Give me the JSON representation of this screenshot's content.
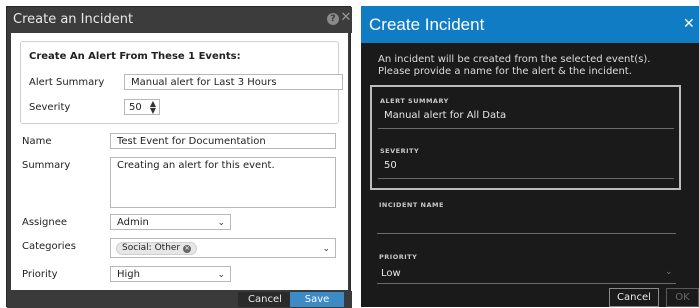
{
  "left_dialog": {
    "title": "Create an Incident",
    "help_icon": "?",
    "close_icon": "✕",
    "group_title": "Create An Alert From These 1 Events:",
    "alert_summary_label": "Alert Summary",
    "alert_summary_value": "Manual alert for Last 3 Hours",
    "severity_label": "Severity",
    "severity_value": "50",
    "name_label": "Name",
    "name_value": "Test Event for Documentation",
    "summary_label": "Summary",
    "summary_value": "Creating an alert for this event.",
    "assignee_label": "Assignee",
    "assignee_value": "Admin",
    "categories_label": "Categories",
    "category_chip": "Social: Other",
    "priority_label": "Priority",
    "priority_value": "High",
    "cancel_label": "Cancel",
    "save_label": "Save"
  },
  "right_dialog": {
    "title": "Create Incident",
    "close_icon": "✕",
    "description": "An incident will be created from the selected event(s). Please provide a name for the alert & the incident.",
    "alert_summary_label": "ALERT SUMMARY",
    "alert_summary_value": "Manual alert for All Data",
    "severity_label": "SEVERITY",
    "severity_value": "50",
    "incident_name_label": "INCIDENT NAME",
    "incident_name_value": "",
    "priority_label": "PRIORITY",
    "priority_value": "Low",
    "cancel_label": "Cancel",
    "ok_label": "OK"
  },
  "colors": {
    "left_title_bg": "#3c3c3c",
    "save_button": "#3c8bc7",
    "right_title_bg": "#0f7cc4",
    "right_body_bg": "#1a1a1a"
  }
}
